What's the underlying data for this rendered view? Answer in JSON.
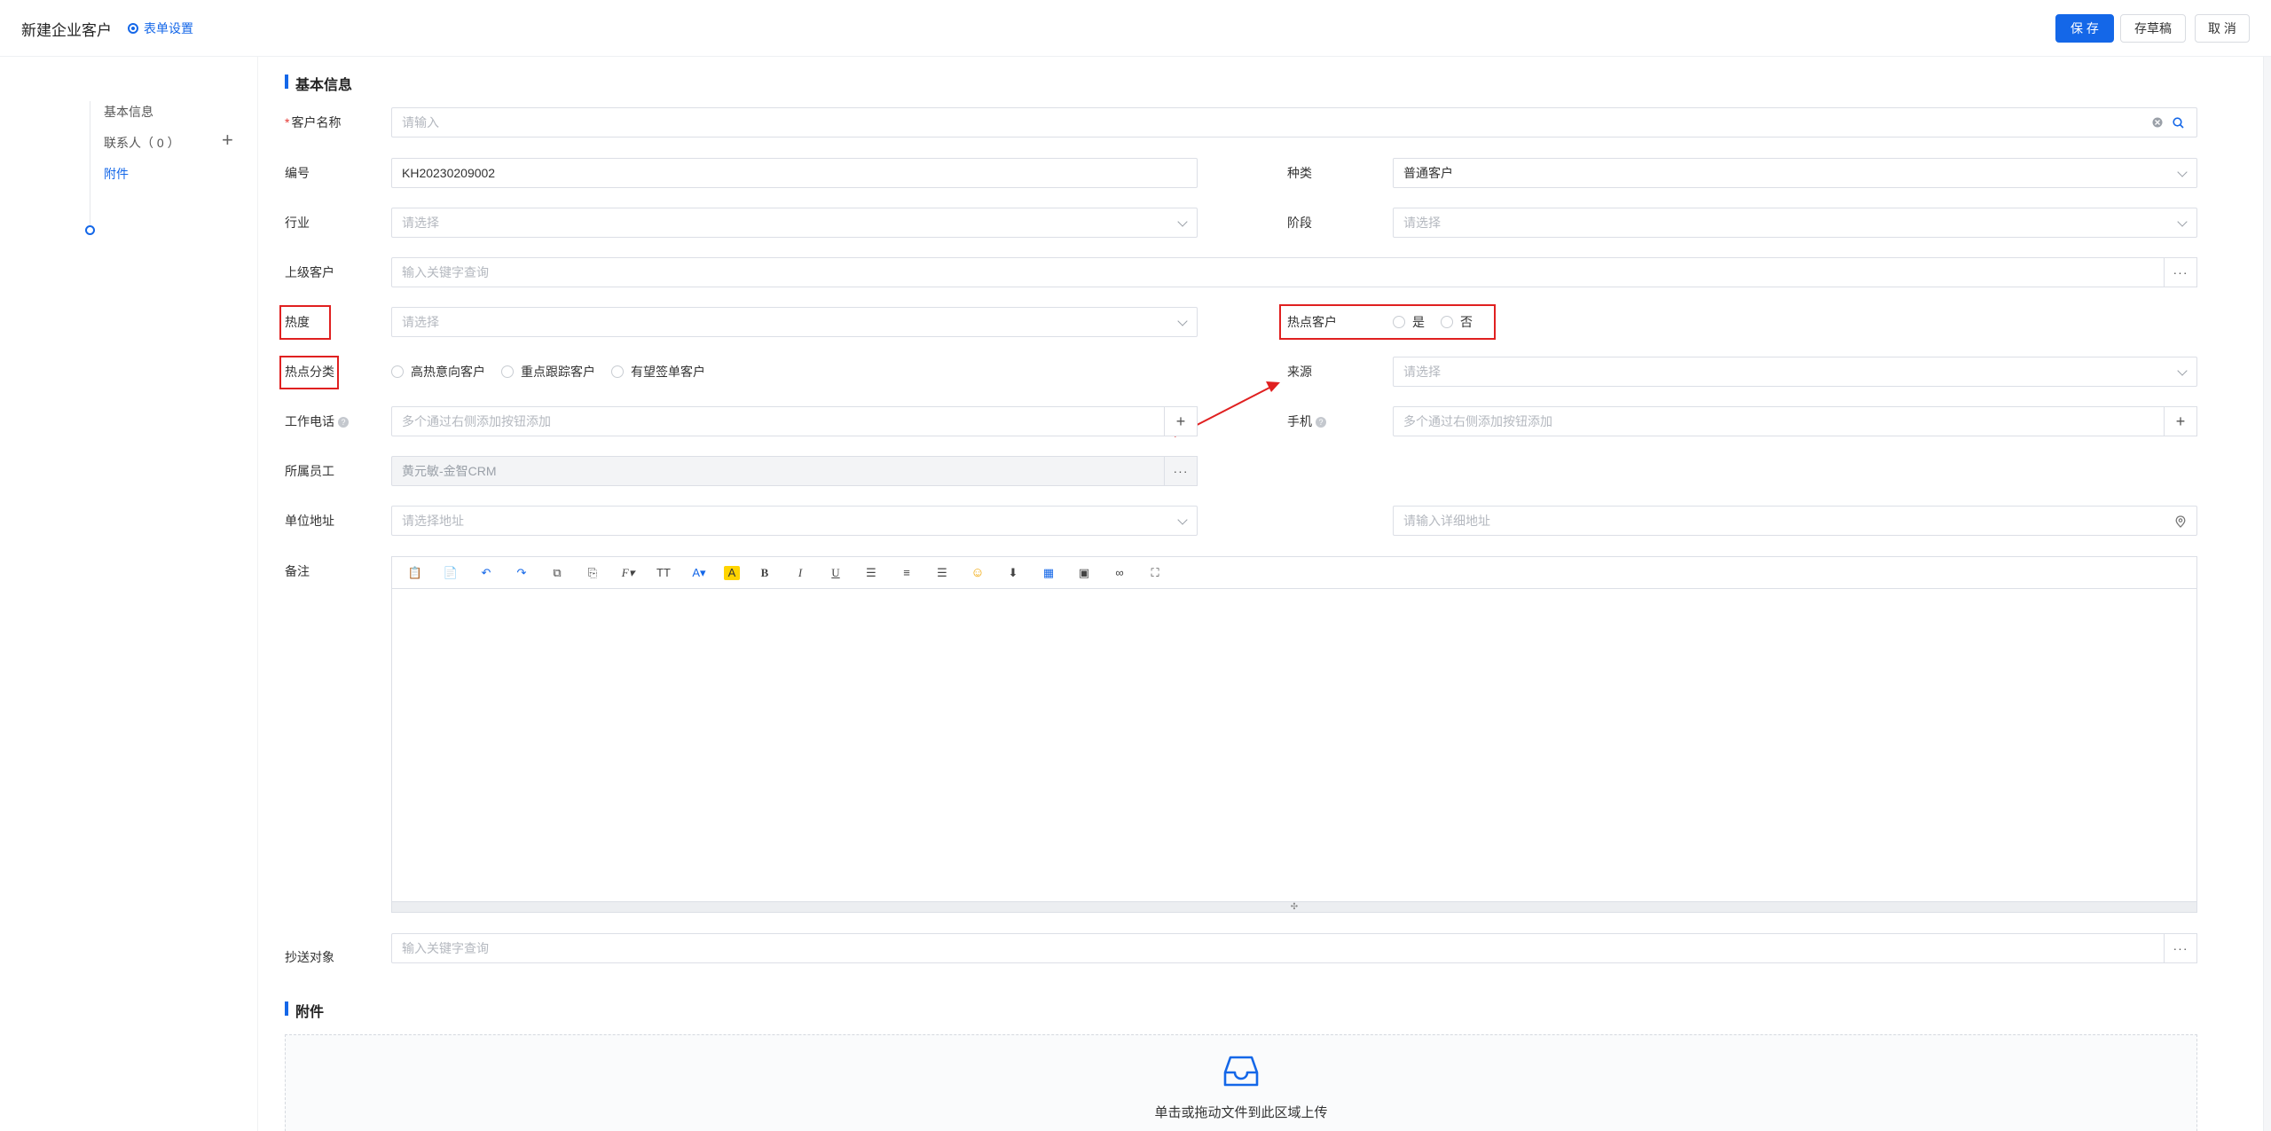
{
  "header": {
    "title": "新建企业客户",
    "form_settings": "表单设置",
    "save": "保 存",
    "draft": "存草稿",
    "cancel": "取 消"
  },
  "nav": {
    "items": [
      "基本信息",
      "联系人（ 0 ）",
      "附件"
    ],
    "plus": "+"
  },
  "sections": {
    "basic": "基本信息",
    "attachment": "附件"
  },
  "fields": {
    "customer_name": {
      "label": "客户名称",
      "required_mark": "*",
      "placeholder": "请输入"
    },
    "number": {
      "label": "编号",
      "value": "KH20230209002"
    },
    "kind": {
      "label": "种类",
      "value": "普通客户"
    },
    "industry": {
      "label": "行业",
      "placeholder": "请选择"
    },
    "stage": {
      "label": "阶段",
      "placeholder": "请选择"
    },
    "parent": {
      "label": "上级客户",
      "placeholder": "输入关键字查询",
      "more": "···"
    },
    "heat": {
      "label": "热度",
      "placeholder": "请选择"
    },
    "hot_customer": {
      "label": "热点客户",
      "options": [
        "是",
        "否"
      ]
    },
    "hot_category": {
      "label": "热点分类",
      "options": [
        "高热意向客户",
        "重点跟踪客户",
        "有望签单客户"
      ]
    },
    "source": {
      "label": "来源",
      "placeholder": "请选择"
    },
    "work_phone": {
      "label": "工作电话",
      "help": "?",
      "placeholder": "多个通过右侧添加按钮添加",
      "add": "+"
    },
    "mobile": {
      "label": "手机",
      "help": "?",
      "placeholder": "多个通过右侧添加按钮添加",
      "add": "+"
    },
    "staff": {
      "label": "所属员工",
      "value": "黄元敏-金智CRM",
      "more": "···"
    },
    "address": {
      "label": "单位地址",
      "placeholder": "请选择地址"
    },
    "address_detail": {
      "placeholder": "请输入详细地址"
    },
    "remark": {
      "label": "备注"
    },
    "cc": {
      "label": "抄送对象",
      "placeholder": "输入关键字查询",
      "more": "···"
    }
  },
  "editor_toolbar": [
    "paste-icon",
    "paste-text-icon",
    "undo-icon",
    "redo-icon",
    "copy-format-icon",
    "paste-format-icon",
    "font-family-icon",
    "font-size-icon",
    "font-color-icon",
    "highlight-icon",
    "bold-icon",
    "italic-icon",
    "underline-icon",
    "align-left-icon",
    "align-center-icon",
    "align-right-icon",
    "emoji-icon",
    "insert-row-icon",
    "table-icon",
    "image-icon",
    "link-icon",
    "fullscreen-icon"
  ],
  "upload": {
    "text": "单击或拖动文件到此区域上传"
  },
  "colors": {
    "accent": "#1467e8",
    "highlight": "#e02020"
  }
}
